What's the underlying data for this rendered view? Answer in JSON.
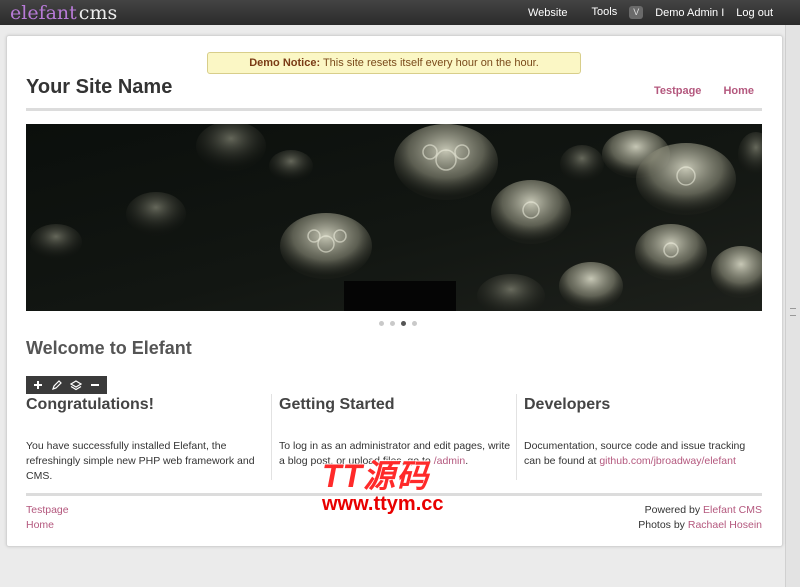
{
  "admin_bar": {
    "logo": {
      "mark": "elefant",
      "cms": "cms"
    },
    "nav": {
      "website": "Website",
      "tools": "Tools",
      "tools_arrow": "V",
      "user": "Demo Admin I",
      "logout": "Log out"
    }
  },
  "notice": {
    "label": "Demo Notice:",
    "text": " This site resets itself every hour on the hour."
  },
  "header": {
    "site_name": "Your Site Name",
    "nav": [
      "Testpage",
      "Home"
    ]
  },
  "slider": {
    "image": "jellyfish-photo",
    "slide_count": 4,
    "active_slide": 3
  },
  "welcome": "Welcome to Elefant",
  "block_toolbar": {
    "icons": [
      "plus-icon",
      "pencil-icon",
      "layers-icon",
      "minus-icon"
    ]
  },
  "columns": [
    {
      "title": "Congratulations!",
      "text": "You have successfully installed Elefant, the refreshingly simple new PHP web framework and CMS.",
      "link": ""
    },
    {
      "title": "Getting Started",
      "text": "To log in as an administrator and edit pages, write a blog post, or upload files, go to ",
      "link": "/admin",
      "suffix": "."
    },
    {
      "title": "Developers",
      "text": "Documentation, source code and issue tracking can be found at ",
      "link": "github.com/jbroadway/elefant"
    }
  ],
  "footer": {
    "links": [
      "Testpage",
      "Home"
    ],
    "powered_prefix": "Powered by ",
    "powered_link": "Elefant CMS",
    "photos_prefix": "Photos by ",
    "photos_link": "Rachael Hosein"
  },
  "watermark": {
    "top": "TT源码",
    "url": "www.ttym.cc"
  },
  "colors": {
    "accent": "#b4587e",
    "topbar": "#333333",
    "notice_bg": "#fbf7c5"
  }
}
